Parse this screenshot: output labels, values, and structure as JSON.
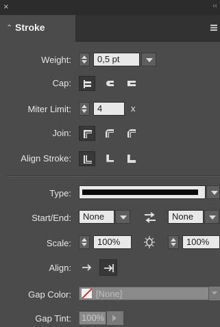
{
  "window": {
    "close_glyph": "×",
    "collapse_glyph": "‹‹"
  },
  "panel": {
    "title": "Stroke",
    "tab_chevron": "⌃",
    "menu_icon": "panel-menu-icon"
  },
  "weight": {
    "label": "Weight:",
    "value": "0,5 pt"
  },
  "cap": {
    "label": "Cap:",
    "options": [
      "butt-cap-icon",
      "round-cap-icon",
      "projecting-cap-icon"
    ],
    "selected": 0
  },
  "miter": {
    "label": "Miter Limit:",
    "value": "4",
    "suffix": "x"
  },
  "join": {
    "label": "Join:",
    "options": [
      "miter-join-icon",
      "round-join-icon",
      "bevel-join-icon"
    ],
    "selected": 0
  },
  "align_stroke": {
    "label": "Align Stroke:",
    "options": [
      "align-center-icon",
      "align-inside-icon",
      "align-outside-icon"
    ],
    "selected": 0
  },
  "type": {
    "label": "Type:"
  },
  "start_end": {
    "label": "Start/End:",
    "start": "None",
    "end": "None"
  },
  "scale": {
    "label": "Scale:",
    "start": "100%",
    "end": "100%"
  },
  "align": {
    "label": "Align:",
    "options": [
      "arrow-extend-icon",
      "arrow-place-inside-icon"
    ],
    "selected": 1
  },
  "gap_color": {
    "label": "Gap Color:",
    "value": "[None]"
  },
  "gap_tint": {
    "label": "Gap Tint:",
    "value": "100%"
  },
  "colors": {
    "panel": "#4b4b4b",
    "field": "#e8e8e8",
    "dark": "#2c2c2c",
    "none_swatch": "#d8262b"
  }
}
